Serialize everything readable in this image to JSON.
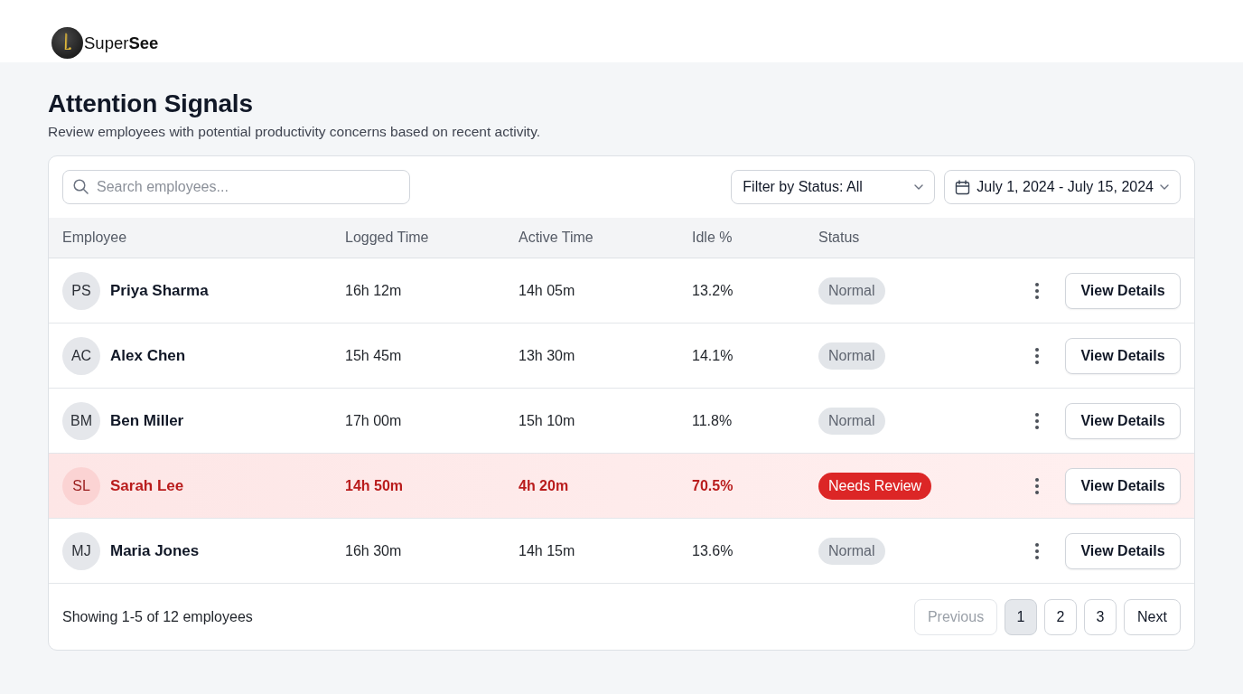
{
  "brand": {
    "name": "Super**See**"
  },
  "page": {
    "title": "Attention Signals",
    "subtitle": "Review employees with potential productivity concerns based on recent activity."
  },
  "toolbar": {
    "search": {
      "placeholder": "Search employees..."
    },
    "status_filter": {
      "value": "Filter by Status: All"
    },
    "date_range": {
      "value": "July 1, 2024 - July 15, 2024"
    }
  },
  "table": {
    "columns": [
      "Employee",
      "Logged Time",
      "Active Time",
      "Idle %",
      "Status"
    ],
    "rows": [
      {
        "initials": "PS",
        "name": "Priya Sharma",
        "logged_time": "16h 12m",
        "active_time": "14h 05m",
        "idle": "13.2%",
        "status": {
          "label": "Normal",
          "kind": "normal"
        },
        "flagged": false,
        "action": "View Details"
      },
      {
        "initials": "AC",
        "name": "Alex Chen",
        "logged_time": "15h 45m",
        "active_time": "13h 30m",
        "idle": "14.1%",
        "status": {
          "label": "Normal",
          "kind": "normal"
        },
        "flagged": false,
        "action": "View Details"
      },
      {
        "initials": "BM",
        "name": "Ben Miller",
        "logged_time": "17h 00m",
        "active_time": "15h 10m",
        "idle": "11.8%",
        "status": {
          "label": "Normal",
          "kind": "normal"
        },
        "flagged": false,
        "action": "View Details"
      },
      {
        "initials": "SL",
        "name": "Sarah Lee",
        "logged_time": "14h 50m",
        "active_time": "4h 20m",
        "idle": "70.5%",
        "status": {
          "label": "Needs Review",
          "kind": "review"
        },
        "flagged": true,
        "action": "View Details"
      },
      {
        "initials": "MJ",
        "name": "Maria Jones",
        "logged_time": "16h 30m",
        "active_time": "14h 15m",
        "idle": "13.6%",
        "status": {
          "label": "Normal",
          "kind": "normal"
        },
        "flagged": false,
        "action": "View Details"
      }
    ]
  },
  "footer": {
    "summary": "Showing 1-5 of 12 employees",
    "pagination": {
      "previous": {
        "label": "Previous",
        "disabled": true
      },
      "pages": [
        {
          "label": "1",
          "selected": true
        },
        {
          "label": "2",
          "selected": false
        },
        {
          "label": "3",
          "selected": false
        }
      ],
      "next": {
        "label": "Next",
        "disabled": false
      }
    }
  }
}
